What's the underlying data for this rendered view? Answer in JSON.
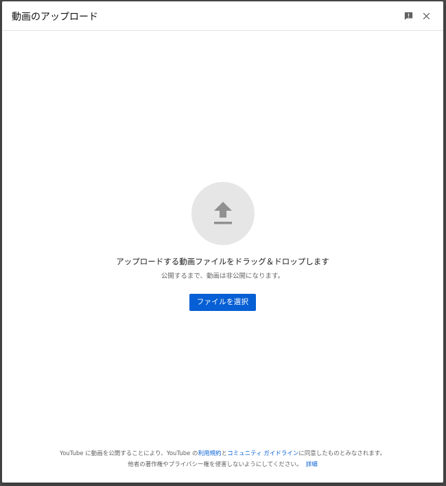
{
  "dialog": {
    "title": "動画のアップロード",
    "feedback_icon": "feedback-icon",
    "close_icon": "close-icon"
  },
  "upload": {
    "icon": "upload-arrow-icon",
    "main_text": "アップロードする動画ファイルをドラッグ＆ドロップします",
    "sub_text": "公開するまで、動画は非公開になります。",
    "select_button": "ファイルを選択"
  },
  "footer": {
    "line1_part1": "YouTube に動画を公開することにより、YouTube の",
    "terms_link": "利用規約",
    "line1_part2": "と",
    "guidelines_link": "コミュニティ ガイドライン",
    "line1_part3": "に同意したものとみなされます。",
    "line2_text": "他者の著作権やプライバシー権を侵害しないようにしてください。",
    "details_link": "詳細"
  },
  "colors": {
    "accent": "#065fd4",
    "circle": "#e6e6e6",
    "icon_gray": "#909090"
  }
}
